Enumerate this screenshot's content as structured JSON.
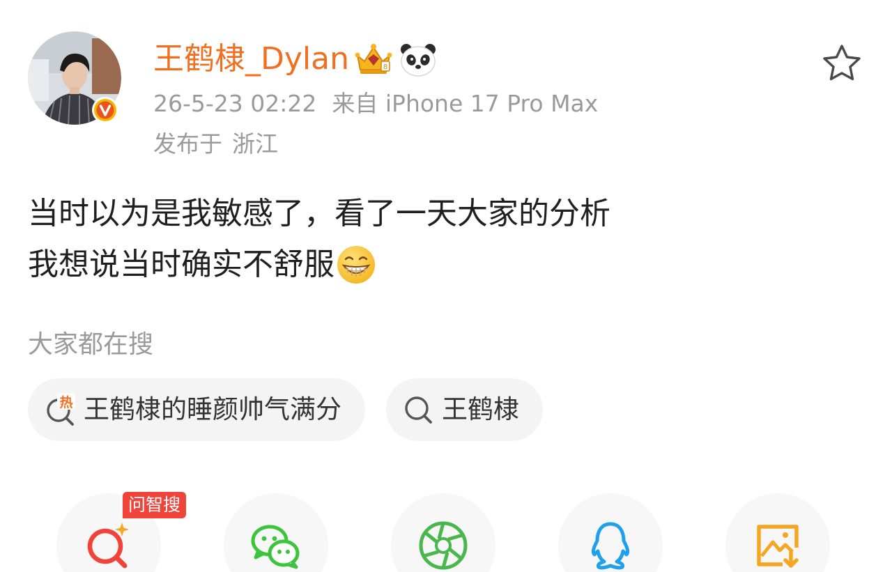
{
  "user": {
    "name": "王鹤棣_Dylan",
    "timestamp": "26-5-23 02:22",
    "source": "来自 iPhone 17 Pro Max",
    "location_prefix": "发布于",
    "location": "浙江",
    "accent_color": "#f26f21"
  },
  "post": {
    "line1": "当时以为是我敏感了，看了一天大家的分析",
    "line2": "我想说当时确实不舒服",
    "emoji": "grinning-face-icon"
  },
  "search": {
    "heading": "大家都在搜",
    "chips": [
      {
        "label": "王鹤棣的睡颜帅气满分",
        "icon": "hot-search-icon",
        "icon_text": "热"
      },
      {
        "label": "王鹤棣",
        "icon": "search-icon"
      }
    ]
  },
  "share": {
    "badge": "问智搜",
    "buttons": [
      {
        "name": "ai-search",
        "icon": "ai-search-icon",
        "color": "#f0443b"
      },
      {
        "name": "wechat",
        "icon": "wechat-icon",
        "color": "#3cc43c"
      },
      {
        "name": "moments",
        "icon": "moments-icon",
        "color": "#49b74b"
      },
      {
        "name": "qq",
        "icon": "qq-icon",
        "color": "#1ea0ea"
      },
      {
        "name": "save-image",
        "icon": "save-image-icon",
        "color": "#f5a623"
      }
    ]
  }
}
